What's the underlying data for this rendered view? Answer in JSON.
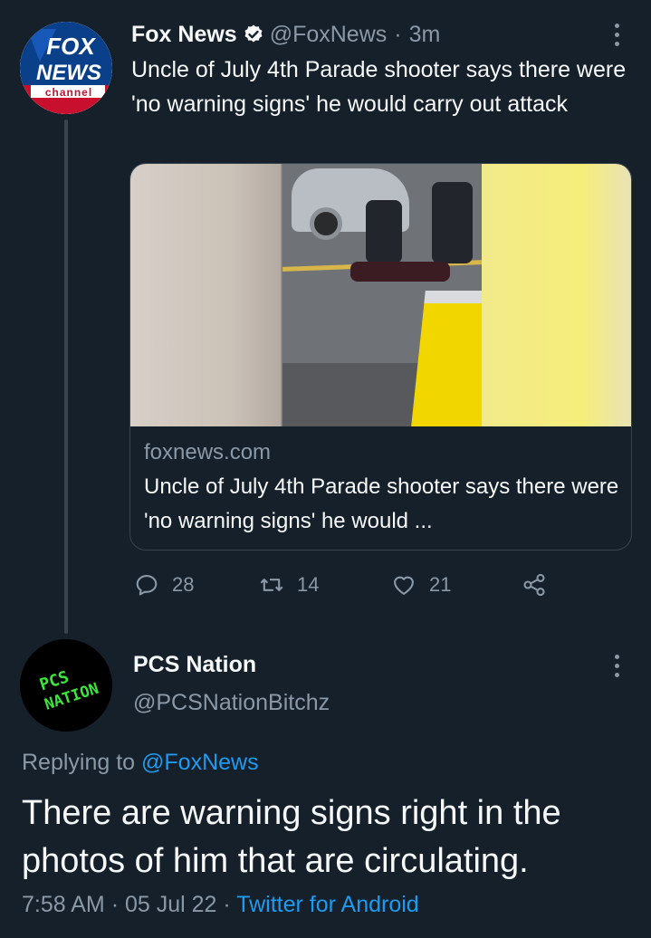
{
  "parent_tweet": {
    "author_name": "Fox News",
    "handle": "@FoxNews",
    "separator": "·",
    "time": "3m",
    "text": "Uncle of July 4th Parade shooter says there were 'no warning signs' he would carry out attack",
    "avatar": {
      "logo_text_top": "FOX",
      "logo_text_mid": "NEWS",
      "logo_text_bottom": "channel"
    },
    "card": {
      "domain": "foxnews.com",
      "title": "Uncle of July 4th Parade shooter says there were 'no warning signs' he would ..."
    },
    "actions": {
      "replies": "28",
      "retweets": "14",
      "likes": "21"
    },
    "icons": {
      "verified": "verified-badge-icon",
      "more": "more-options-icon",
      "reply": "reply-icon",
      "retweet": "retweet-icon",
      "like": "heart-icon",
      "share": "share-icon"
    }
  },
  "reply_tweet": {
    "author_name": "PCS Nation",
    "handle": "@PCSNationBitchz",
    "avatar": {
      "logo_text_1": "PCS",
      "logo_text_2": "NATION"
    },
    "replying_label": "Replying to",
    "replying_handle": "@FoxNews",
    "text": "There are warning signs right in the photos of him that are circulating.",
    "time": "7:58 AM",
    "separator": "·",
    "date": "05 Jul 22",
    "separator2": "·",
    "source": "Twitter for Android"
  },
  "colors": {
    "background": "#15202b",
    "text_primary": "#f7f9f9",
    "text_secondary": "#8b98a5",
    "accent": "#1d9bf0",
    "border": "#38444d"
  }
}
